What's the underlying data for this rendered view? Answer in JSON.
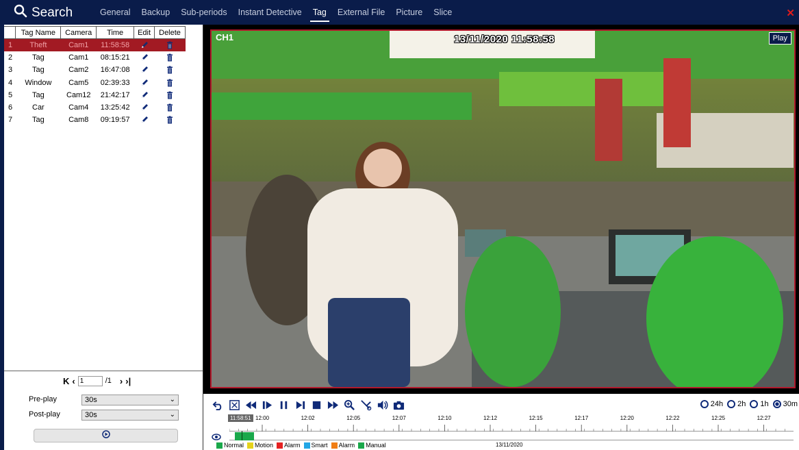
{
  "header": {
    "title": "Search",
    "tabs": [
      {
        "label": "General"
      },
      {
        "label": "Backup"
      },
      {
        "label": "Sub-periods"
      },
      {
        "label": "Instant Detective"
      },
      {
        "label": "Tag"
      },
      {
        "label": "External File"
      },
      {
        "label": "Picture"
      },
      {
        "label": "Slice"
      }
    ],
    "active_tab": "Tag",
    "close_icon": "close-icon",
    "close_color": "#e01b1b"
  },
  "tag_table": {
    "columns": [
      "Tag Name",
      "Camera",
      "Time",
      "Edit",
      "Delete"
    ],
    "rows": [
      {
        "index": "1",
        "name": "Theft",
        "camera": "Cam1",
        "time": "11:58:58",
        "selected": true
      },
      {
        "index": "2",
        "name": "Tag",
        "camera": "Cam1",
        "time": "08:15:21"
      },
      {
        "index": "3",
        "name": "Tag",
        "camera": "Cam2",
        "time": "16:47:08"
      },
      {
        "index": "4",
        "name": "Window",
        "camera": "Cam5",
        "time": "02:39:33"
      },
      {
        "index": "5",
        "name": "Tag",
        "camera": "Cam12",
        "time": "21:42:17"
      },
      {
        "index": "6",
        "name": "Car",
        "camera": "Cam4",
        "time": "13:25:42"
      },
      {
        "index": "7",
        "name": "Tag",
        "camera": "Cam8",
        "time": "09:19:57"
      }
    ],
    "edit_icon": "pencil-icon",
    "delete_icon": "trash-icon",
    "selected_color": "#a21a23"
  },
  "pagination": {
    "current_page": "1",
    "total": "/1"
  },
  "preplay": {
    "label": "Pre-play",
    "value": "30s"
  },
  "postplay": {
    "label": "Post-play",
    "value": "30s"
  },
  "video": {
    "channel": "CH1",
    "timestamp": "13/11/2020 11:58:58",
    "status": "Play",
    "border_color": "#b2182b"
  },
  "playback": {
    "controls": [
      "undo-icon",
      "fullscreen-icon",
      "rewind-icon",
      "step-forward-icon",
      "pause-icon",
      "next-frame-icon",
      "stop-icon",
      "fast-forward-icon",
      "zoom-icon",
      "clip-icon",
      "volume-icon",
      "snapshot-icon"
    ],
    "ranges": [
      "24h",
      "2h",
      "1h",
      "30m"
    ],
    "selected_range": "30m"
  },
  "timeline": {
    "cursor_time": "11:58:51",
    "labels": [
      "12:00",
      "12:02",
      "12:05",
      "12:07",
      "12:10",
      "12:12",
      "12:15",
      "12:17",
      "12:20",
      "12:22",
      "12:25",
      "12:27"
    ],
    "date": "13/11/2020",
    "recording_color": "#1aa84b"
  },
  "legend": [
    {
      "label": "Normal",
      "color": "#1aa84b"
    },
    {
      "label": "Motion",
      "color": "#e5d21b"
    },
    {
      "label": "Alarm",
      "color": "#e52222"
    },
    {
      "label": "Smart",
      "color": "#22a6e5"
    },
    {
      "label": "Alarm",
      "color": "#f07d14"
    },
    {
      "label": "Manual",
      "color": "#1aa84b"
    }
  ]
}
